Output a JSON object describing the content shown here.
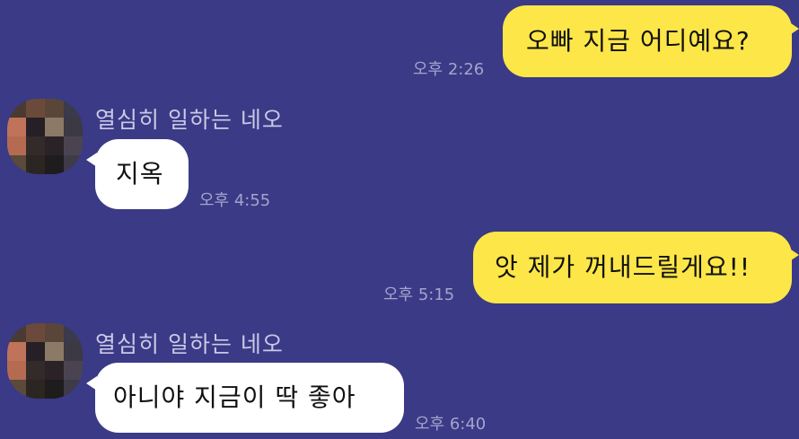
{
  "colors": {
    "background": "#3a3a86",
    "outgoing_bubble": "#fde648",
    "incoming_bubble": "#ffffff",
    "timestamp_text": "#a3a4cc",
    "sender_name_text": "#c9c9e6"
  },
  "messages": [
    {
      "direction": "outgoing",
      "text": "오빠 지금 어디예요?",
      "time": "오후 2:26"
    },
    {
      "direction": "incoming",
      "sender": "열심히 일하는 네오",
      "text": "지옥",
      "time": "오후 4:55",
      "avatar_icon": "pixelated-avatar-icon"
    },
    {
      "direction": "outgoing",
      "text": "앗 제가 꺼내드릴게요!!",
      "time": "오후 5:15"
    },
    {
      "direction": "incoming",
      "sender": "열심히 일하는 네오",
      "text": "아니야 지금이 딱 좋아",
      "time": "오후 6:40",
      "avatar_icon": "pixelated-avatar-icon"
    }
  ]
}
